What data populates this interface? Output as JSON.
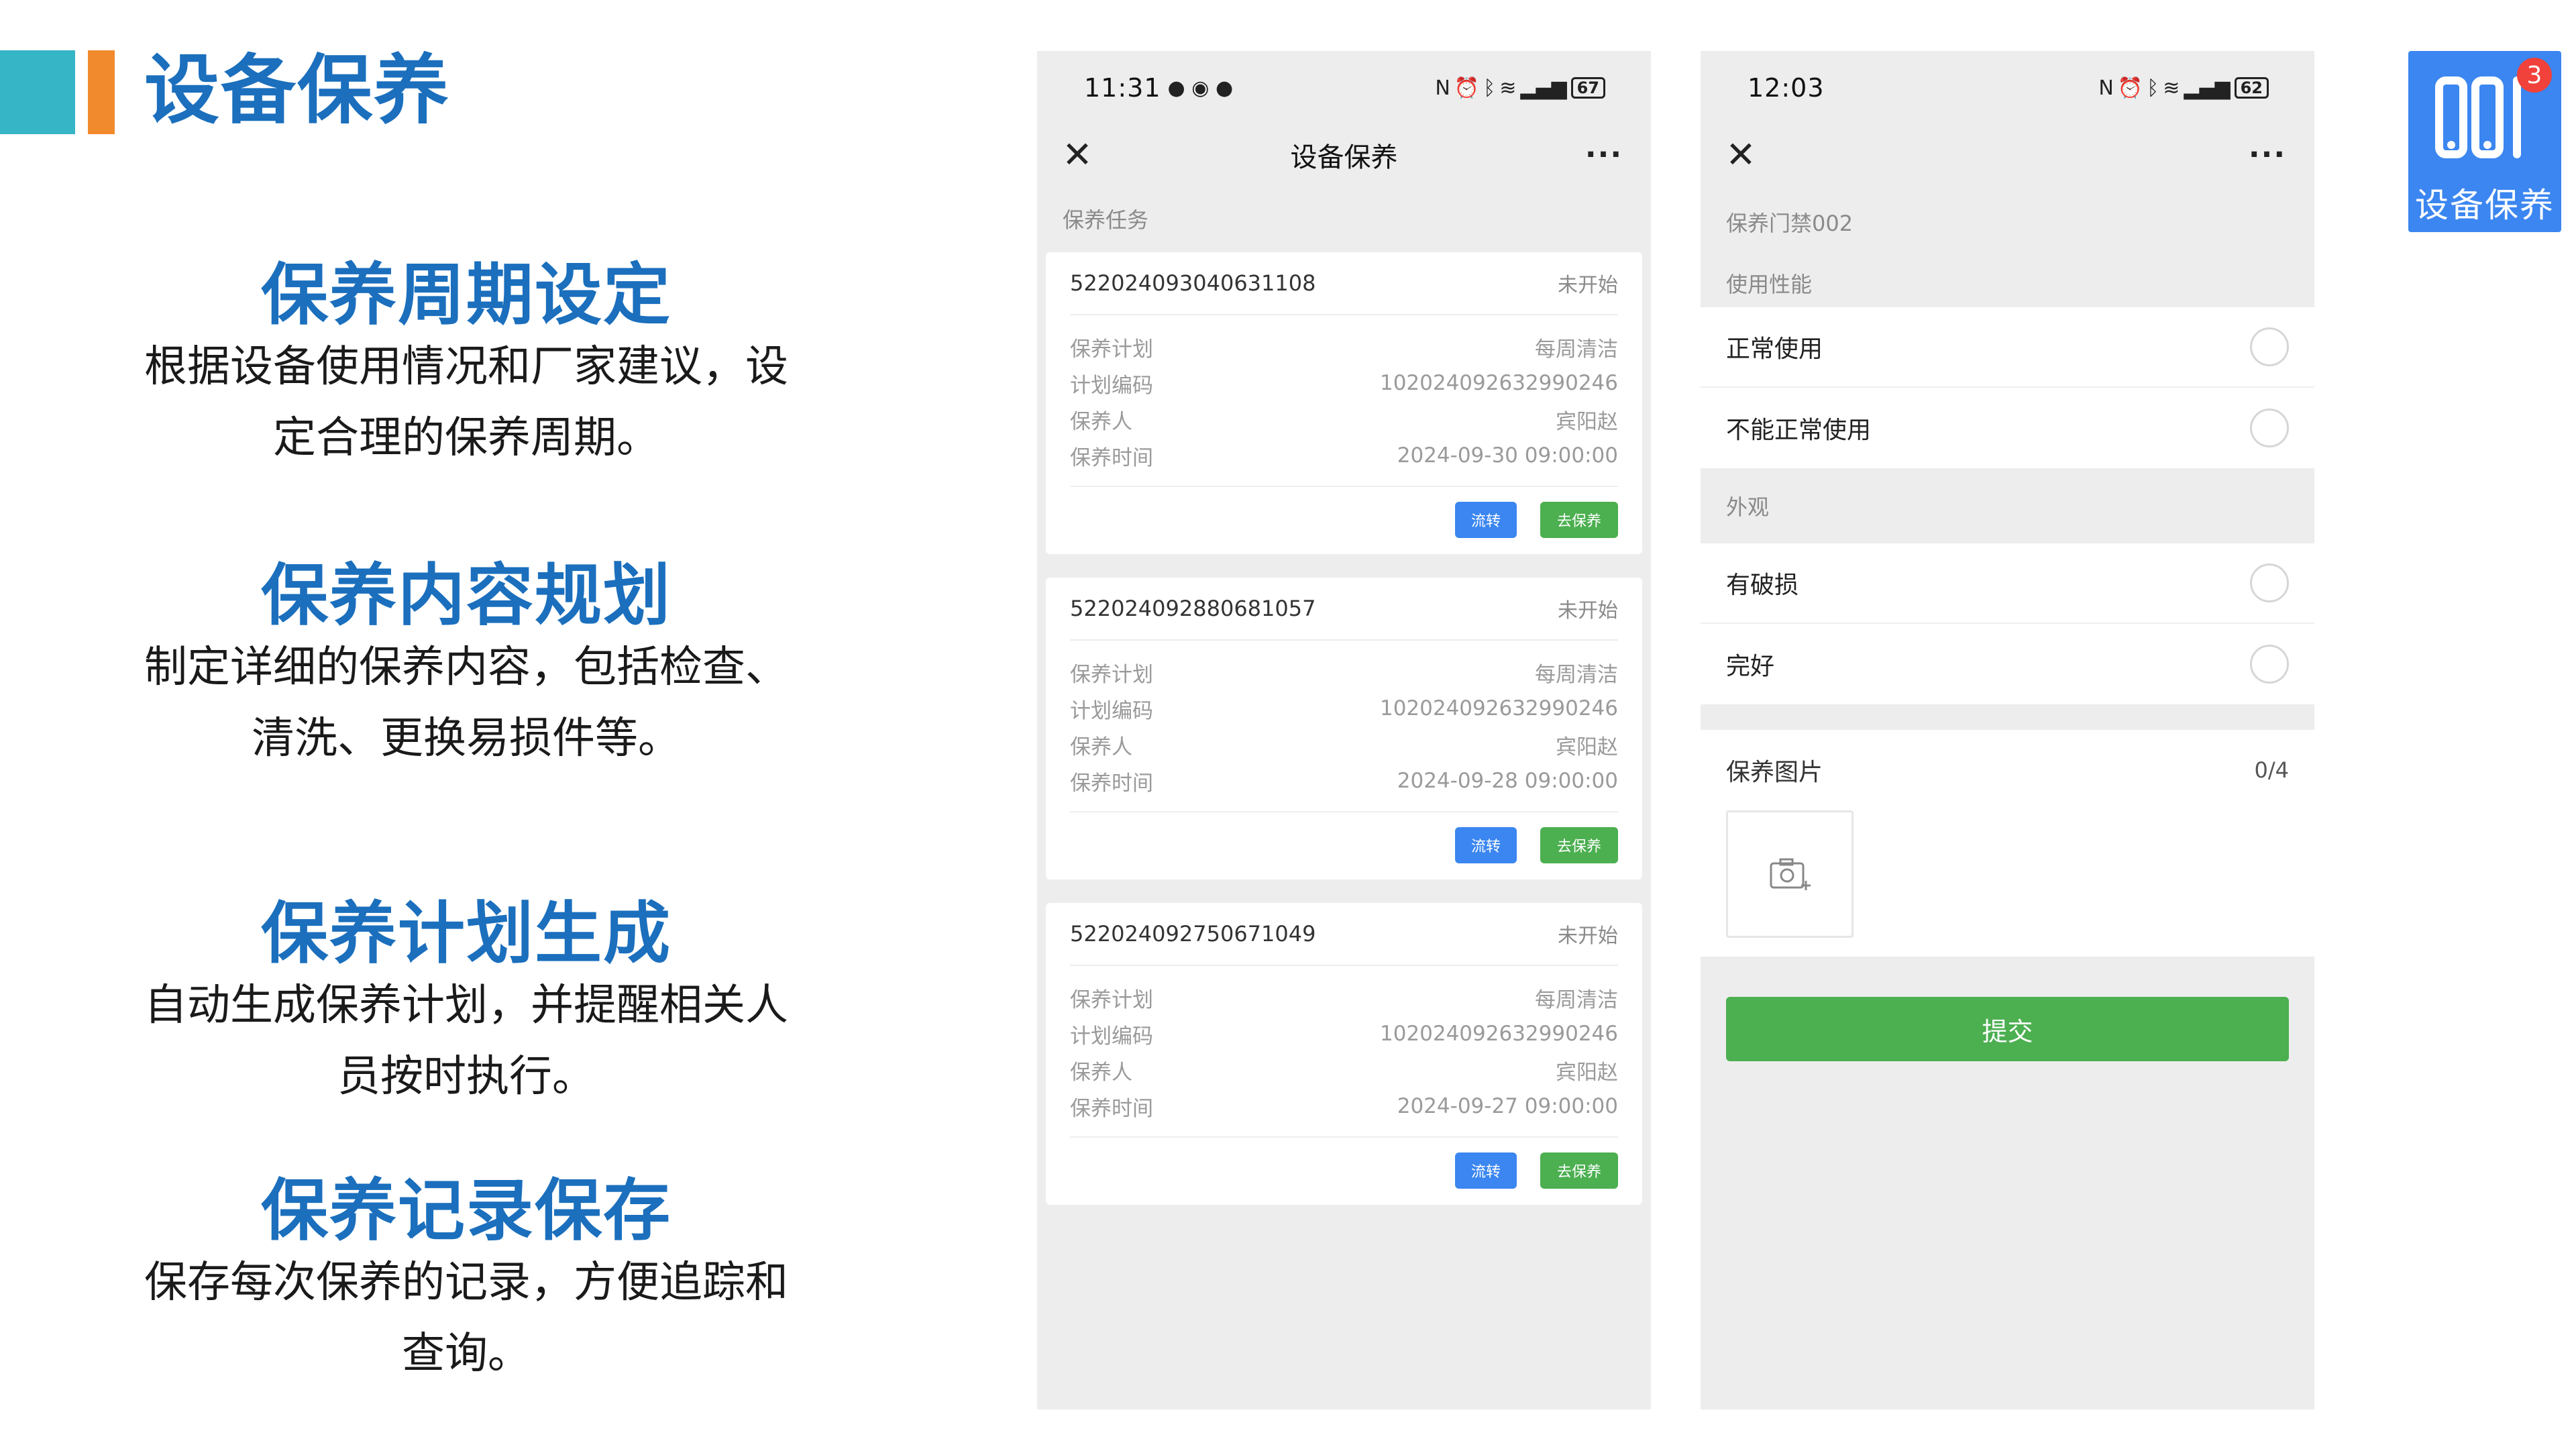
{
  "header": {
    "title": "设备保养"
  },
  "features": [
    {
      "title": "保养周期设定",
      "desc": "根据设备使用情况和厂家建议，设定合理的保养周期。"
    },
    {
      "title": "保养内容规划",
      "desc": "制定详细的保养内容，包括检查、清洗、更换易损件等。"
    },
    {
      "title": "保养计划生成",
      "desc": "自动生成保养计划，并提醒相关人员按时执行。"
    },
    {
      "title": "保养记录保存",
      "desc": "保存每次保养的记录，方便追踪和查询。"
    }
  ],
  "phone1": {
    "status": {
      "time": "11:31",
      "battery": "67"
    },
    "nav": {
      "title": "设备保养",
      "close_icon": "close-icon",
      "more_icon": "more-icon"
    },
    "section_label": "保养任务",
    "cards": [
      {
        "id": "522024093040631108",
        "status": "未开始",
        "rows": [
          {
            "label": "保养计划",
            "value": "每周清洁"
          },
          {
            "label": "计划编码",
            "value": "102024092632990246"
          },
          {
            "label": "保养人",
            "value": "宾阳赵"
          },
          {
            "label": "保养时间",
            "value": "2024-09-30 09:00:00"
          }
        ],
        "btn_transfer": "流转",
        "btn_go": "去保养"
      },
      {
        "id": "522024092880681057",
        "status": "未开始",
        "rows": [
          {
            "label": "保养计划",
            "value": "每周清洁"
          },
          {
            "label": "计划编码",
            "value": "102024092632990246"
          },
          {
            "label": "保养人",
            "value": "宾阳赵"
          },
          {
            "label": "保养时间",
            "value": "2024-09-28 09:00:00"
          }
        ],
        "btn_transfer": "流转",
        "btn_go": "去保养"
      },
      {
        "id": "522024092750671049",
        "status": "未开始",
        "rows": [
          {
            "label": "保养计划",
            "value": "每周清洁"
          },
          {
            "label": "计划编码",
            "value": "102024092632990246"
          },
          {
            "label": "保养人",
            "value": "宾阳赵"
          },
          {
            "label": "保养时间",
            "value": "2024-09-27 09:00:00"
          }
        ],
        "btn_transfer": "流转",
        "btn_go": "去保养"
      }
    ]
  },
  "phone2": {
    "status": {
      "time": "12:03",
      "battery": "62"
    },
    "nav": {
      "close_icon": "close-icon",
      "more_icon": "more-icon"
    },
    "device_label": "保养门禁002",
    "group1": {
      "label": "使用性能",
      "options": [
        "正常使用",
        "不能正常使用"
      ]
    },
    "group2": {
      "label": "外观",
      "options": [
        "有破损",
        "完好"
      ]
    },
    "photos": {
      "label": "保养图片",
      "count": "0/4"
    },
    "submit_label": "提交"
  },
  "app_icon": {
    "label": "设备保养",
    "badge": "3"
  },
  "colors": {
    "title_blue": "#1b6fbd",
    "accent_teal": "#36b5c6",
    "accent_orange": "#f18a2c",
    "btn_blue": "#3b86f0",
    "btn_green": "#4caf50"
  }
}
